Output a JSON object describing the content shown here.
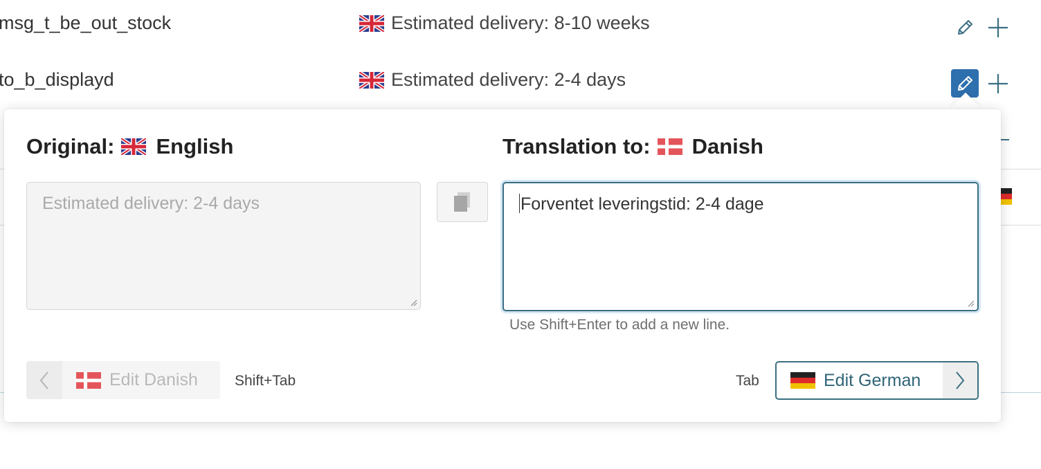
{
  "rows": [
    {
      "key": "msg_t_be_out_stock",
      "value": "Estimated delivery: 8-10 weeks",
      "flag_icon": "uk-flag-icon"
    },
    {
      "key": "to_b_displayd",
      "value": "Estimated delivery: 2-4 days",
      "flag_icon": "uk-flag-icon"
    }
  ],
  "popover": {
    "original_label": "Original:",
    "original_language": "English",
    "translation_label": "Translation to:",
    "translation_language": "Danish",
    "original_text": "Estimated delivery: 2-4 days",
    "translation_text": "Forventet leveringstid: 2-4 dage",
    "hint": "Use Shift+Enter to add a new line.",
    "prev_button_label": "Edit Danish",
    "prev_shortcut": "Shift+Tab",
    "next_shortcut": "Tab",
    "next_button_label": "Edit German"
  },
  "colors": {
    "accent": "#3a6f82",
    "active_button": "#2e6fae",
    "focus_ring": "#d4e6f4",
    "danish_red": "#e4555b"
  },
  "icons": [
    "pencil-icon",
    "plus-icon",
    "copy-icon",
    "chevron-left-icon",
    "chevron-right-icon",
    "uk-flag-icon",
    "danish-flag-icon",
    "german-flag-icon"
  ]
}
